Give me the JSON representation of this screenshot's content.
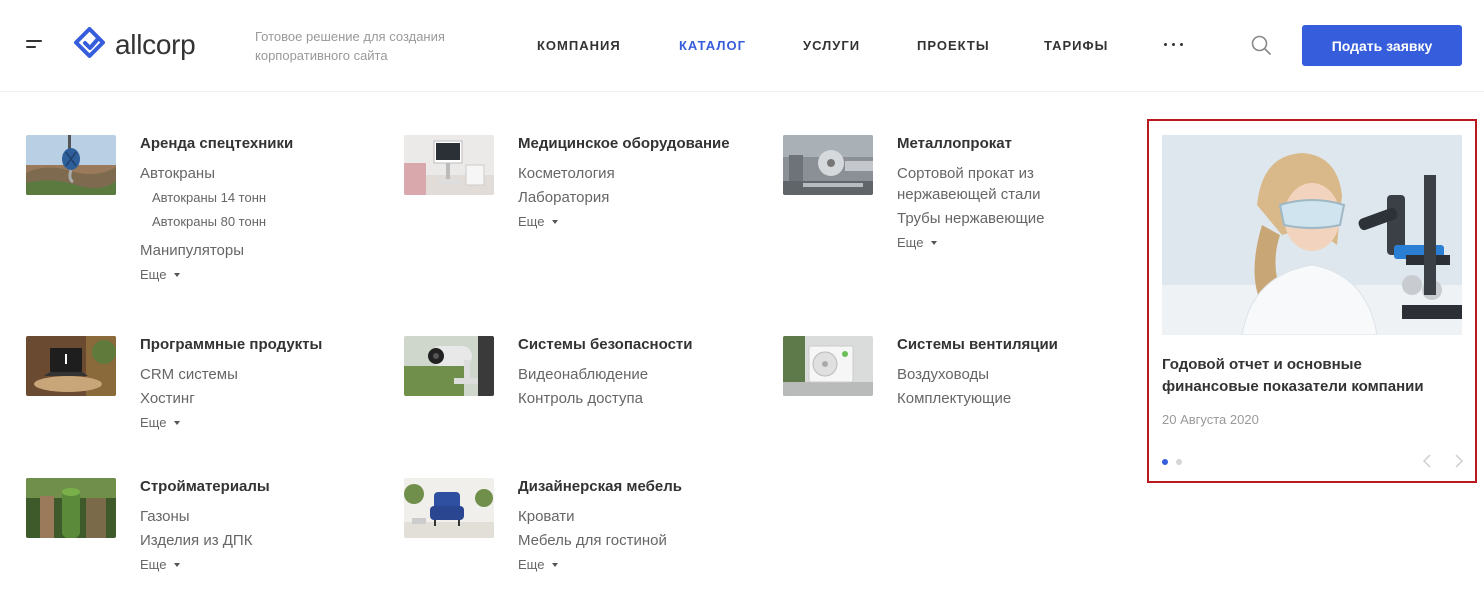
{
  "header": {
    "logo_text": "allcorp",
    "tagline": "Готовое решение для создания корпоративного сайта",
    "nav": [
      {
        "label": "Компания",
        "active": false
      },
      {
        "label": "Каталог",
        "active": true
      },
      {
        "label": "Услуги",
        "active": false
      },
      {
        "label": "Проекты",
        "active": false
      },
      {
        "label": "Тарифы",
        "active": false
      }
    ],
    "cta_label": "Подать заявку",
    "icons": {
      "menu": "burger-icon",
      "more": "more-dots-icon",
      "search": "search-icon"
    }
  },
  "catalog": [
    {
      "title": "Аренда спецтехники",
      "links": [
        "Автокраны"
      ],
      "sublinks": [
        "Автокраны 14 тонн",
        "Автокраны 80 тонн"
      ],
      "links_after": [
        "Манипуляторы"
      ],
      "more": "Еще"
    },
    {
      "title": "Медицинское оборудование",
      "links": [
        "Косметология",
        "Лаборатория"
      ],
      "more": "Еще"
    },
    {
      "title": "Металлопрокат",
      "links": [
        "Сортовой прокат из нержавеющей стали",
        "Трубы нержавеющие"
      ],
      "more": "Еще"
    },
    {
      "title": "Программные продукты",
      "links": [
        "CRM системы",
        "Хостинг"
      ],
      "more": "Еще"
    },
    {
      "title": "Системы безопасности",
      "links": [
        "Видеонаблюдение",
        "Контроль доступа"
      ]
    },
    {
      "title": "Системы вентиляции",
      "links": [
        "Воздуховоды",
        "Комплектующие"
      ]
    },
    {
      "title": "Стройматериалы",
      "links": [
        "Газоны",
        "Изделия из ДПК"
      ],
      "more": "Еще"
    },
    {
      "title": "Дизайнерская мебель",
      "links": [
        "Кровати",
        "Мебель для гостиной"
      ],
      "more": "Еще"
    }
  ],
  "news": {
    "title": "Годовой отчет и основные финансовые показатели компании",
    "date": "20 Августа 2020",
    "slides": 2,
    "current_slide": 1
  },
  "colors": {
    "accent": "#365edc",
    "highlight_frame": "#b81a20",
    "text": "#333333",
    "muted": "#999999"
  }
}
